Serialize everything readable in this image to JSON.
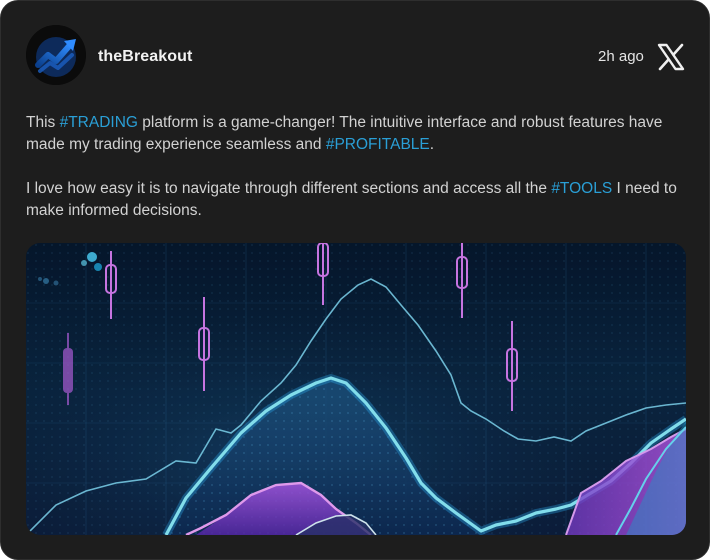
{
  "author": {
    "name": "theBreakout",
    "avatar_icon": "trending-up-chart-logo"
  },
  "meta": {
    "time": "2h ago",
    "platform_icon": "x-logo-icon"
  },
  "post": {
    "paragraph1": {
      "t1": "This ",
      "tag1": "#TRADING",
      "t2": " platform is a game-changer! The intuitive interface and robust features have made my trading experience seamless and ",
      "tag2": "#PROFITABLE",
      "t3": "."
    },
    "paragraph2": {
      "t1": "I love how easy it is to navigate through different sections and access all the ",
      "tag1": "#TOOLS",
      "t2": " I need to make informed decisions."
    }
  },
  "media": {
    "subject": "trading-chart-image"
  },
  "colors": {
    "card_background": "#1d1d1d",
    "hashtag": "#2a9fd6",
    "username": "#f2f2f2",
    "body_text": "#d2d2d2"
  }
}
